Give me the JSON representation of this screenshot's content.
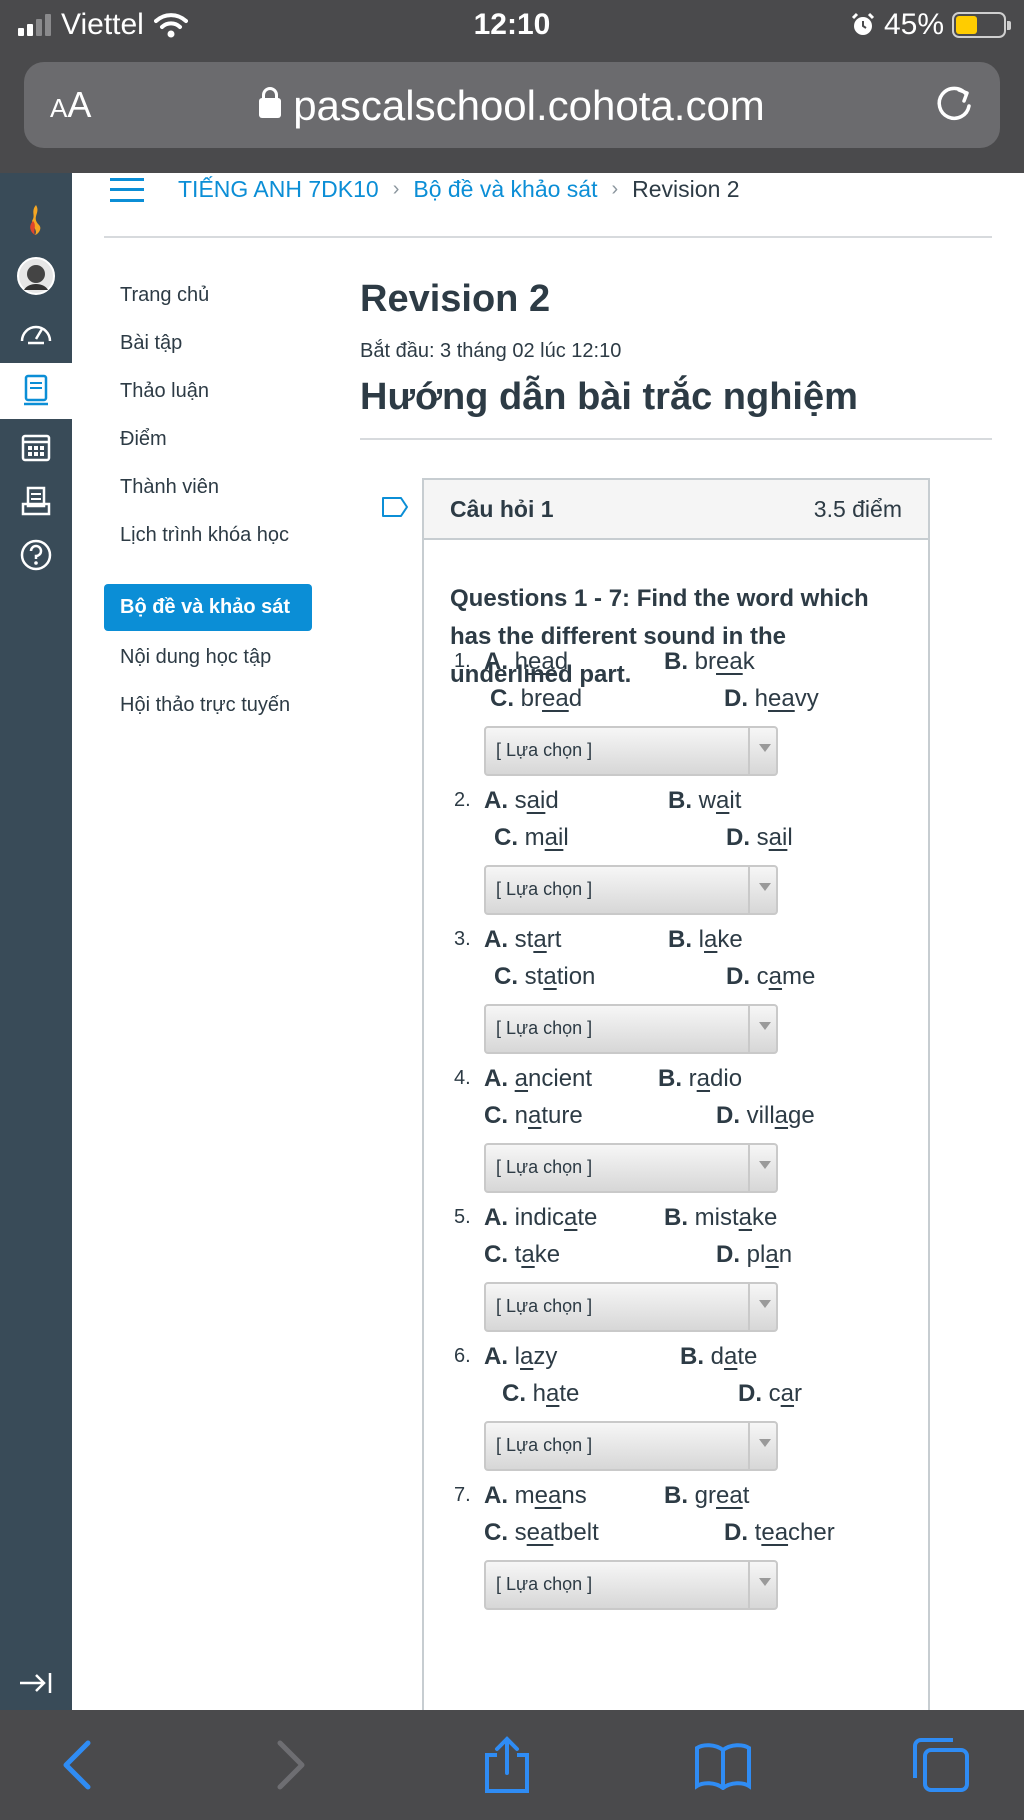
{
  "status_bar": {
    "carrier": "Viettel",
    "time": "12:10",
    "battery": "45%"
  },
  "browser": {
    "text_size_label_small": "A",
    "text_size_label_large": "A",
    "url": "pascalschool.cohota.com"
  },
  "breadcrumb": {
    "course": "TIẾNG ANH 7DK10",
    "section": "Bộ đề và khảo sát",
    "current": "Revision 2"
  },
  "course_nav": {
    "items": [
      {
        "label": "Trang chủ"
      },
      {
        "label": "Bài tập"
      },
      {
        "label": "Thảo luận"
      },
      {
        "label": "Điểm"
      },
      {
        "label": "Thành viên"
      },
      {
        "label": "Lịch trình khóa học"
      },
      {
        "label": "Bộ đề và khảo sát"
      },
      {
        "label": "Nội dung học tập"
      },
      {
        "label": "Hội thảo trực tuyến"
      }
    ],
    "active_index": 6
  },
  "main": {
    "title": "Revision 2",
    "start_info": "Bắt đầu: 3 tháng 02 lúc 12:10",
    "heading": "Hướng dẫn bài trắc nghiệm"
  },
  "question": {
    "title": "Câu hỏi 1",
    "points": "3.5 điểm",
    "prompt": "Questions 1 - 7: Find the word which has the different sound in the underlined part.",
    "select_placeholder": "[ Lựa chọn ]",
    "items": [
      {
        "num": "1.",
        "A": "head",
        "B": "break",
        "C": "bread",
        "D": "heavy"
      },
      {
        "num": "2.",
        "A": "said",
        "B": "wait",
        "C": "mail",
        "D": "sail"
      },
      {
        "num": "3.",
        "A": "start",
        "B": "lake",
        "C": "station",
        "D": "came"
      },
      {
        "num": "4.",
        "A": "ancient",
        "B": "radio",
        "C": "nature",
        "D": "village"
      },
      {
        "num": "5.",
        "A": "indicate",
        "B": "mistake",
        "C": "take",
        "D": "plan"
      },
      {
        "num": "6.",
        "A": "lazy",
        "B": "date",
        "C": "hate",
        "D": "car"
      },
      {
        "num": "7.",
        "A": "means",
        "B": "great",
        "C": "seatbelt",
        "D": "teacher"
      }
    ]
  },
  "colors": {
    "accent": "#0b8ed6",
    "nav_bg": "#394b58",
    "text": "#2d3b45",
    "battery": "#ffcc00"
  },
  "icons": [
    "signal-icon",
    "wifi-icon",
    "alarm-icon",
    "battery-icon",
    "lock-icon",
    "reload-icon",
    "logo-icon",
    "account-avatar",
    "dashboard-icon",
    "courses-icon",
    "calendar-icon",
    "inbox-icon",
    "help-icon",
    "collapse-nav-icon",
    "hamburger-icon",
    "flag-icon",
    "back-icon",
    "forward-icon",
    "share-icon",
    "bookmarks-icon",
    "tabs-icon"
  ]
}
